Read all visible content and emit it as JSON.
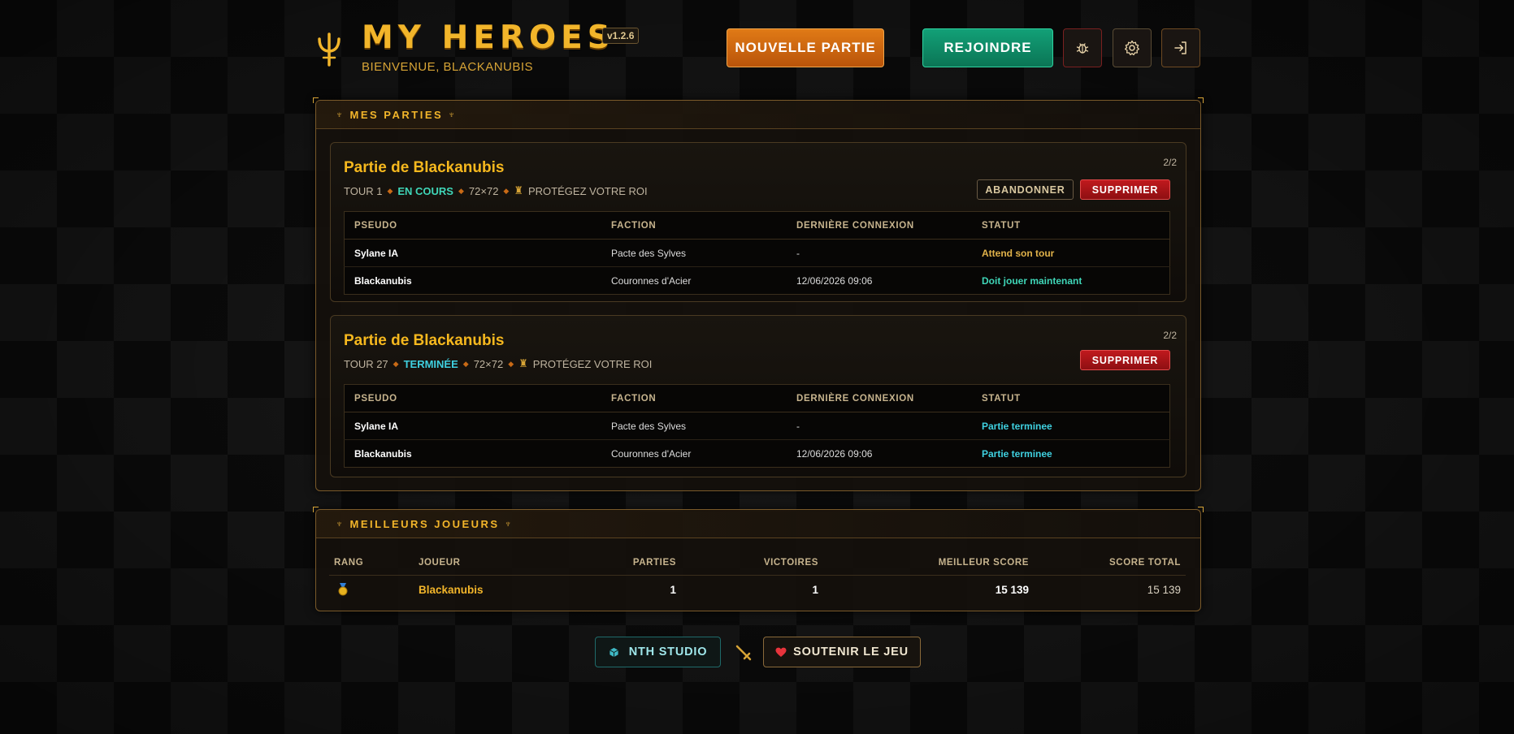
{
  "header": {
    "title": "MY HEROES",
    "version": "v1.2.6",
    "welcome": "BIENVENUE, BLACKANUBIS",
    "new_game_label": "NOUVELLE PARTIE",
    "join_label": "REJOINDRE",
    "icons": [
      "bug-icon",
      "gear-icon",
      "logout-icon"
    ]
  },
  "games_panel": {
    "title": "MES PARTIES",
    "columns": [
      "PSEUDO",
      "FACTION",
      "DERNIÈRE CONNEXION",
      "STATUT"
    ],
    "games": [
      {
        "title": "Partie de Blackanubis",
        "turn": "TOUR 1",
        "status": "EN COURS",
        "size": "72×72",
        "objective": "PROTÉGEZ VOTRE ROI",
        "count": "2/2",
        "abandon_label": "ABANDONNER",
        "delete_label": "SUPPRIMER",
        "players": [
          {
            "pseudo": "Sylane IA",
            "faction": "Pacte des Sylves",
            "last": "-",
            "statut": "Attend son tour"
          },
          {
            "pseudo": "Blackanubis",
            "faction": "Couronnes d'Acier",
            "last": "12/06/2026 09:06",
            "statut": "Doit jouer maintenant"
          }
        ]
      },
      {
        "title": "Partie de Blackanubis",
        "turn": "TOUR 27",
        "status": "TERMINÉE",
        "size": "72×72",
        "objective": "PROTÉGEZ VOTRE ROI",
        "count": "2/2",
        "delete_label": "SUPPRIMER",
        "players": [
          {
            "pseudo": "Sylane IA",
            "faction": "Pacte des Sylves",
            "last": "-",
            "statut": "Partie terminee"
          },
          {
            "pseudo": "Blackanubis",
            "faction": "Couronnes d'Acier",
            "last": "12/06/2026 09:06",
            "statut": "Partie terminee"
          }
        ]
      }
    ]
  },
  "leaderboard": {
    "title": "MEILLEURS JOUEURS",
    "columns": [
      "RANG",
      "JOUEUR",
      "PARTIES",
      "VICTOIRES",
      "MEILLEUR SCORE",
      "SCORE TOTAL"
    ],
    "rows": [
      {
        "rank_icon": "gold-medal-icon",
        "player": "Blackanubis",
        "games": "1",
        "wins": "1",
        "best": "15 139",
        "total": "15 139"
      }
    ]
  },
  "footer": {
    "studio_label": "NTH STUDIO",
    "support_label": "SOUTENIR LE JEU"
  },
  "colors": {
    "gold": "#f2b52a",
    "orange_button": "#e07a16",
    "green_button": "#12a077",
    "red_button": "#c0191d",
    "status_waiting": "#e0b24a",
    "status_active": "#3fd6b8",
    "status_teal": "#3fd0e0"
  }
}
